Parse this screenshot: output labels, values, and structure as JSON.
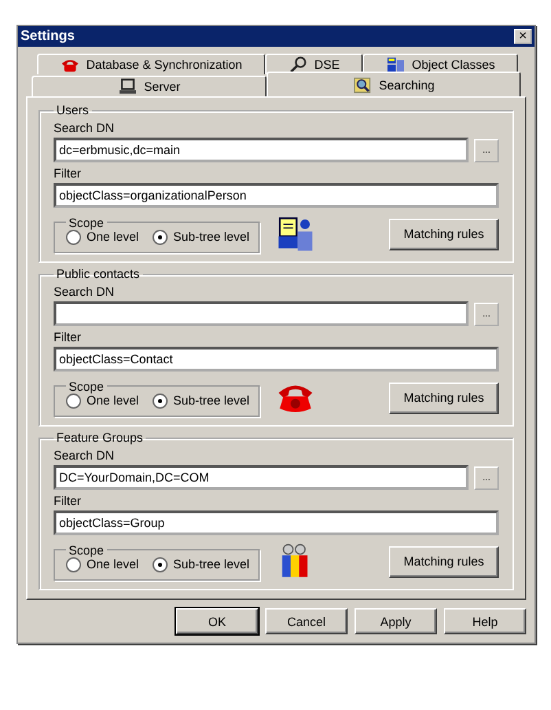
{
  "window": {
    "title": "Settings",
    "close": "×"
  },
  "tab_rows": [
    [
      {
        "label": "Database & Synchronization",
        "kind": "phone",
        "selected": false
      },
      {
        "label": "DSE",
        "kind": "magnifier",
        "selected": false
      },
      {
        "label": "Object Classes",
        "kind": "classes",
        "selected": false
      }
    ],
    [
      {
        "label": "Server",
        "kind": "server",
        "selected": false
      },
      {
        "label": "Searching",
        "kind": "search",
        "selected": true
      }
    ]
  ],
  "groups": [
    {
      "title": "Users",
      "kind": "users",
      "search_dn": {
        "label": "Search DN",
        "value": "dc=erbmusic,dc=main",
        "browse": "..."
      },
      "filter": {
        "label": "Filter",
        "value": "objectClass=organizationalPerson"
      },
      "scope": {
        "label": "Scope",
        "options": [
          {
            "label": "One level",
            "selected": false
          },
          {
            "label": "Sub-tree level",
            "selected": true
          }
        ]
      },
      "button": "Matching rules"
    },
    {
      "title": "Public contacts",
      "kind": "phone",
      "search_dn": {
        "label": "Search DN",
        "browse": "..."
      },
      "filter": {
        "label": "Filter",
        "value": "objectClass=Contact"
      },
      "scope": {
        "label": "Scope",
        "options": [
          {
            "label": "One level",
            "selected": false
          },
          {
            "label": "Sub-tree level",
            "selected": true
          }
        ]
      },
      "button": "Matching rules"
    },
    {
      "title": "Feature Groups",
      "kind": "group",
      "search_dn": {
        "label": "Search DN",
        "value": "DC=YourDomain,DC=COM",
        "browse": "..."
      },
      "filter": {
        "label": "Filter",
        "value": "objectClass=Group"
      },
      "scope": {
        "label": "Scope",
        "options": [
          {
            "label": "One level",
            "selected": false
          },
          {
            "label": "Sub-tree level",
            "selected": true
          }
        ]
      },
      "button": "Matching rules"
    }
  ],
  "buttons": [
    {
      "label": "OK",
      "default": true
    },
    {
      "label": "Cancel",
      "default": false
    },
    {
      "label": "Apply",
      "default": false
    },
    {
      "label": "Help",
      "default": false
    }
  ]
}
